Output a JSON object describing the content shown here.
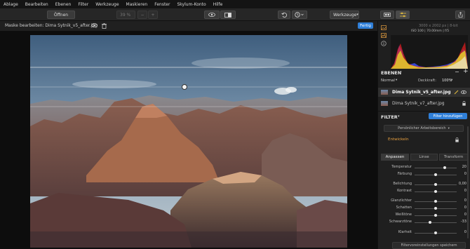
{
  "menu": [
    "Ablage",
    "Bearbeiten",
    "Ebenen",
    "Filter",
    "Werkzeuge",
    "Maskieren",
    "Fenster",
    "Skylum-Konto",
    "Hilfe"
  ],
  "toolbar": {
    "open_label": "Öffnen",
    "zoom_value": "39 %",
    "zoom_out": "−",
    "zoom_in": "+",
    "tools_label": "Werkzeuge"
  },
  "mask_bar": {
    "title": "Maske bearbeiten: Dima Sytnik_v5_after.jpg",
    "done_label": "Fertig"
  },
  "info": {
    "dimensions": "3000 x 2002 px  |  8-bit",
    "exif": "ISO 100  |  70.00mm  |  f/5"
  },
  "layers": {
    "header": "EBENEN",
    "blend_mode": "Normal",
    "opacity_label": "Deckkraft:",
    "opacity_value": "100%",
    "items": [
      {
        "name": "Dima Sytnik_v5_after.jpg"
      },
      {
        "name": "Dima Sytnik_v7_after.jpg"
      }
    ]
  },
  "filters": {
    "header": "FILTER",
    "add_label": "Filter hinzufügen",
    "workspace": "Persönlicher Arbeitsbereich",
    "develop_label": "Entwickeln",
    "tabs": [
      "Anpassen",
      "Linse",
      "Transform"
    ],
    "sliders": [
      {
        "label": "Temperatur",
        "value": "20",
        "pos": 0.72
      },
      {
        "label": "Färbung",
        "value": "0",
        "pos": 0.5
      },
      {
        "label": "Belichtung",
        "value": "0,00",
        "pos": 0.5
      },
      {
        "label": "Kontrast",
        "value": "0",
        "pos": 0.5
      },
      {
        "label": "Glanzlichter",
        "value": "0",
        "pos": 0.5
      },
      {
        "label": "Schatten",
        "value": "0",
        "pos": 0.5
      },
      {
        "label": "Weißtöne",
        "value": "0",
        "pos": 0.5
      },
      {
        "label": "Schwarztöne",
        "value": "-33",
        "pos": 0.37
      },
      {
        "label": "Klarheit",
        "value": "0",
        "pos": 0.5
      }
    ],
    "save_label": "Filtervoreinstellungen speichern"
  },
  "colors": {
    "accent": "#2f7fd8",
    "develop": "#e8a040"
  }
}
